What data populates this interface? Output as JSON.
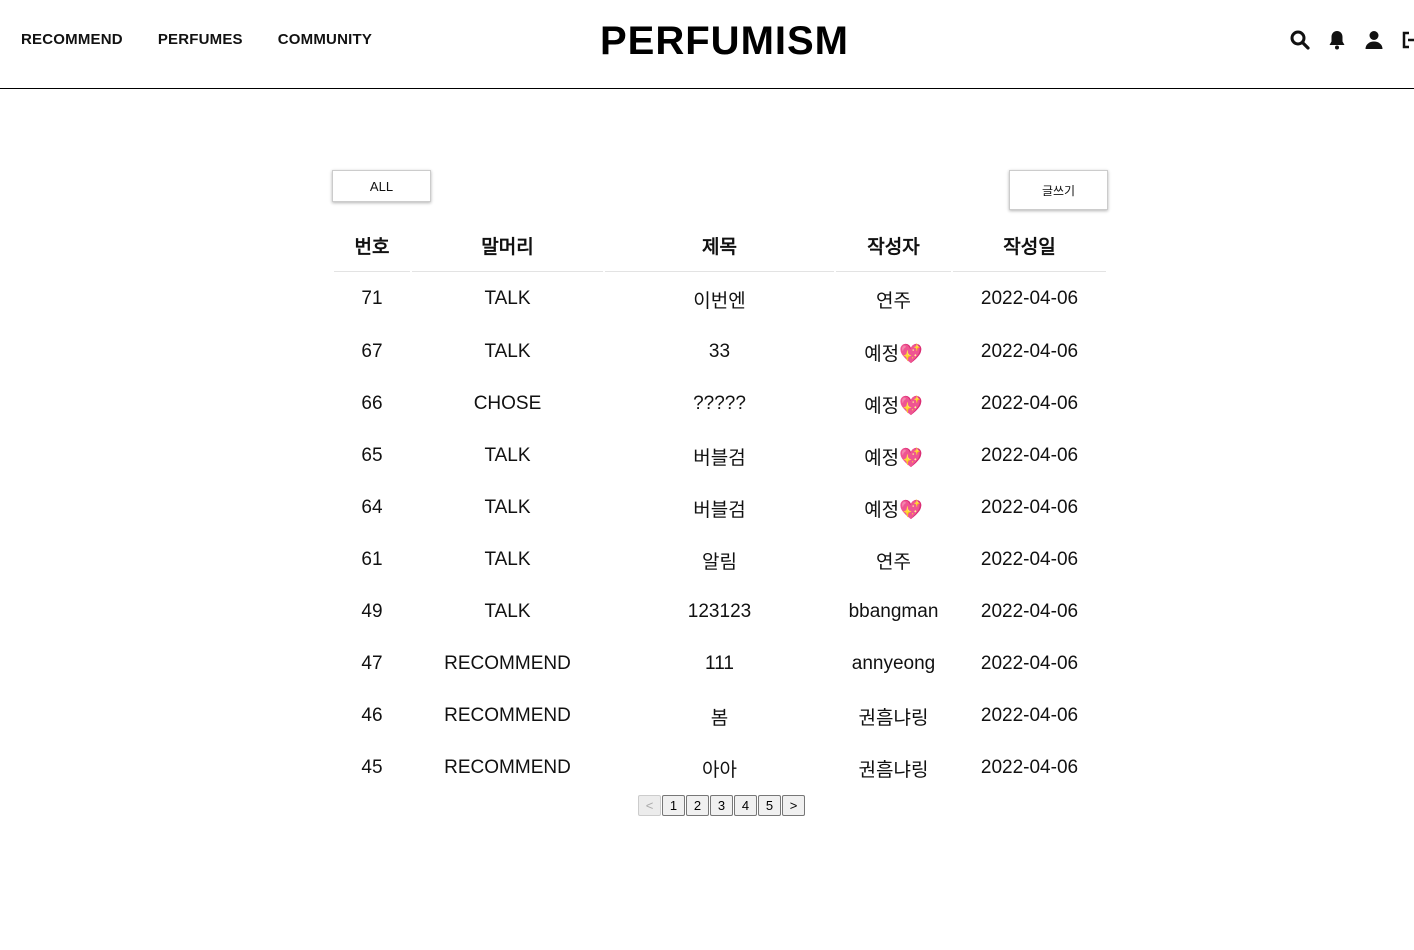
{
  "header": {
    "nav": [
      {
        "label": "RECOMMEND"
      },
      {
        "label": "PERFUMES"
      },
      {
        "label": "COMMUNITY"
      }
    ],
    "logo": "PERFUMISM",
    "icons": [
      "search-icon",
      "bell-icon",
      "user-icon",
      "logout-icon"
    ]
  },
  "toolbar": {
    "filter_label": "ALL",
    "write_label": "글쓰기"
  },
  "table": {
    "columns": [
      "번호",
      "말머리",
      "제목",
      "작성자",
      "작성일"
    ],
    "rows": [
      {
        "no": "71",
        "category": "TALK",
        "title": "이번엔",
        "author": "연주",
        "date": "2022-04-06"
      },
      {
        "no": "67",
        "category": "TALK",
        "title": "33",
        "author": "예정💖",
        "date": "2022-04-06"
      },
      {
        "no": "66",
        "category": "CHOSE",
        "title": "?????",
        "author": "예정💖",
        "date": "2022-04-06"
      },
      {
        "no": "65",
        "category": "TALK",
        "title": "버블검",
        "author": "예정💖",
        "date": "2022-04-06"
      },
      {
        "no": "64",
        "category": "TALK",
        "title": "버블검",
        "author": "예정💖",
        "date": "2022-04-06"
      },
      {
        "no": "61",
        "category": "TALK",
        "title": "알림",
        "author": "연주",
        "date": "2022-04-06"
      },
      {
        "no": "49",
        "category": "TALK",
        "title": "123123",
        "author": "bbangman",
        "date": "2022-04-06"
      },
      {
        "no": "47",
        "category": "RECOMMEND",
        "title": "111",
        "author": "annyeong",
        "date": "2022-04-06"
      },
      {
        "no": "46",
        "category": "RECOMMEND",
        "title": "봄",
        "author": "권흠냐링",
        "date": "2022-04-06"
      },
      {
        "no": "45",
        "category": "RECOMMEND",
        "title": "아아",
        "author": "권흠냐링",
        "date": "2022-04-06"
      }
    ]
  },
  "pagination": {
    "prev": "<",
    "pages": [
      "1",
      "2",
      "3",
      "4",
      "5"
    ],
    "next": ">"
  }
}
